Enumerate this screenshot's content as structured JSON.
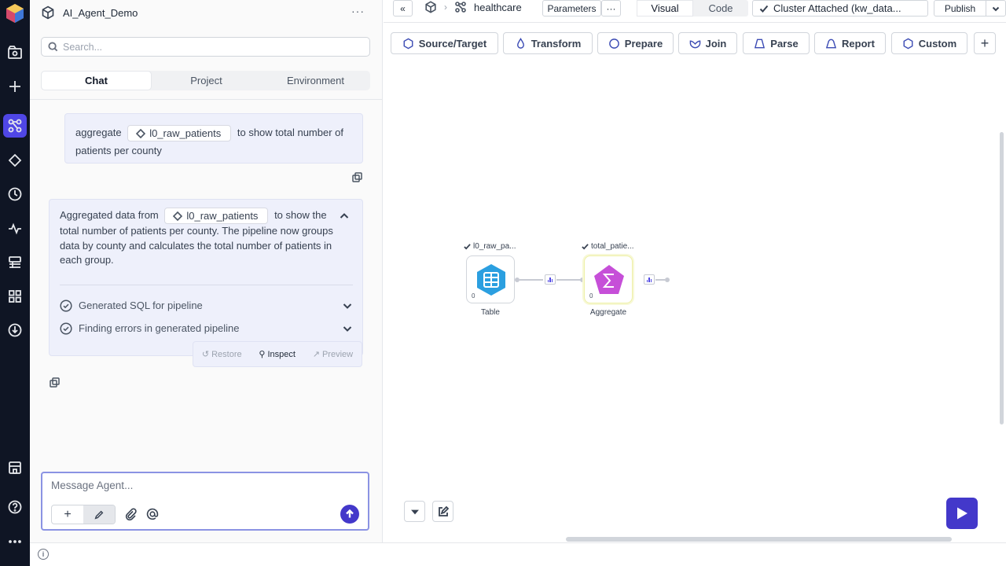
{
  "project": {
    "title": "AI_Agent_Demo",
    "menu": "···"
  },
  "search": {
    "placeholder": "Search..."
  },
  "tabs": [
    {
      "label": "Chat"
    },
    {
      "label": "Project"
    },
    {
      "label": "Environment"
    }
  ],
  "chat": {
    "user_message": {
      "before": "aggregate",
      "dataset": "l0_raw_patients",
      "after": "to show total number of patients per county"
    },
    "agent_message": {
      "before": "Aggregated data from",
      "dataset": "l0_raw_patients",
      "after": "to show the total number of patients per county. The pipeline now groups data by county and calculates the total number of patients in each group.",
      "steps": [
        {
          "label": "Generated SQL for pipeline"
        },
        {
          "label": "Finding errors in generated pipeline"
        }
      ],
      "actions": {
        "restore": "Restore",
        "inspect": "Inspect",
        "preview": "Preview"
      }
    },
    "composer": {
      "placeholder": "Message Agent..."
    }
  },
  "topbar": {
    "collapse": "«",
    "pipeline_name": "healthcare",
    "parameters": "Parameters",
    "more": "···",
    "view_tabs": [
      {
        "label": "Visual"
      },
      {
        "label": "Code"
      }
    ],
    "cluster": "Cluster Attached (kw_data...",
    "publish": "Publish"
  },
  "gems": [
    {
      "label": "Source/Target",
      "icon": "hexagon-icon"
    },
    {
      "label": "Transform",
      "icon": "drop-icon"
    },
    {
      "label": "Prepare",
      "icon": "circle-icon"
    },
    {
      "label": "Join",
      "icon": "join-icon"
    },
    {
      "label": "Parse",
      "icon": "trapezoid-icon"
    },
    {
      "label": "Report",
      "icon": "bell-icon"
    },
    {
      "label": "Custom",
      "icon": "hexagon-icon"
    }
  ],
  "canvas": {
    "nodes": [
      {
        "title": "l0_raw_pa...",
        "label": "Table",
        "count": "0",
        "icon": "table-icon",
        "color": "#2b9fe0"
      },
      {
        "title": "total_patie...",
        "label": "Aggregate",
        "count": "0",
        "icon": "sigma-icon",
        "color": "#c64fd8"
      }
    ]
  },
  "colors": {
    "accent": "#4338ca",
    "rail": "#0f1524"
  }
}
